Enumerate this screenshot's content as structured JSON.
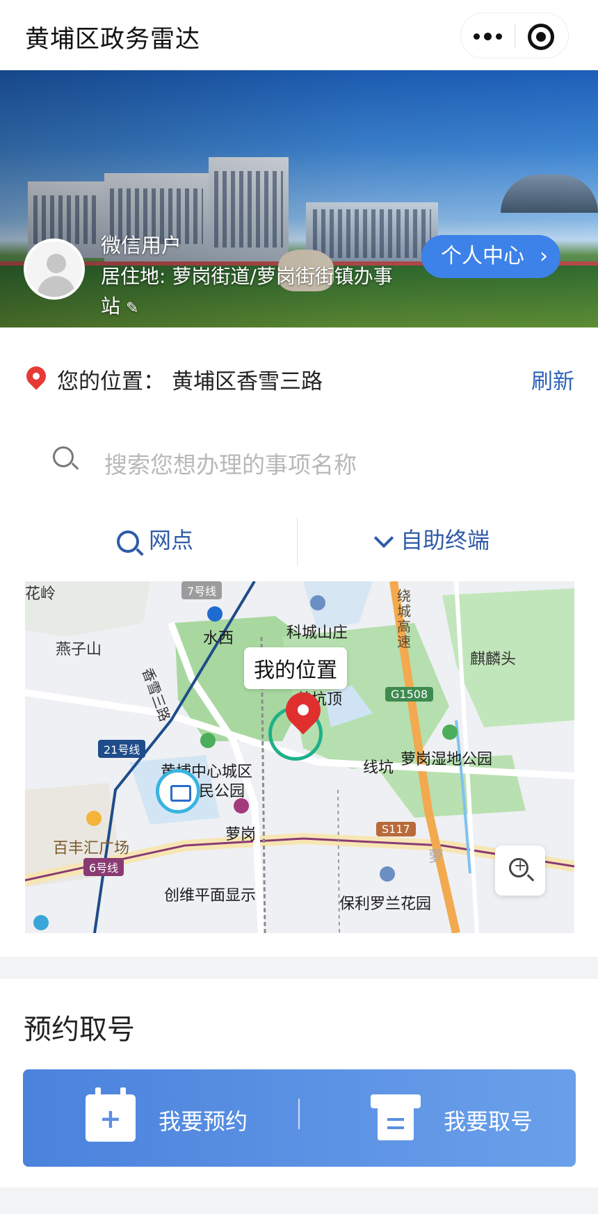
{
  "app": {
    "title": "黄埔区政务雷达"
  },
  "capsule": {
    "more_icon": "more-dots-icon",
    "close_icon": "target-icon"
  },
  "banner": {
    "user_name": "微信用户",
    "residence": "居住地: 萝岗街道/萝岗街街镇办事站",
    "personal_center": "个人中心",
    "personal_center_chevron": "›"
  },
  "location": {
    "label": "您的位置：",
    "value": "黄埔区香雪三路",
    "refresh": "刷新"
  },
  "search": {
    "placeholder": "搜索您想办理的事项名称"
  },
  "tabs": [
    {
      "label": "网点",
      "icon": "search-icon"
    },
    {
      "label": "自助终端",
      "icon": "chevron-down-icon"
    }
  ],
  "map": {
    "my_location": "我的位置",
    "labels": {
      "hualing": "花岭",
      "yanzishan": "燕子山",
      "shuixi": "水西",
      "kecheng": "科城山庄",
      "xiangxue3": "香雪三路",
      "shankengding": "善坑顶",
      "qilintou": "麒麟头",
      "xiankeng": "线坑",
      "luogang_park": "萝岗湿地公园",
      "huangpu_center": "黄埔中心城区",
      "min_park": "民公园",
      "luogang": "萝岗",
      "baifeng": "百丰汇广场",
      "chuangwei": "创维平面显示",
      "baoli": "保利罗兰花园",
      "raocheng": "绕城高速",
      "lu": "路",
      "luogang_right": "萝",
      "guang": "广"
    },
    "badges": {
      "line7": "7号线",
      "line21": "21号线",
      "line6": "6号线",
      "g1508": "G1508",
      "s117": "S117"
    },
    "zoom_icon": "zoom-in-icon"
  },
  "appointment": {
    "title": "预约取号",
    "book": "我要预约",
    "take": "我要取号"
  }
}
